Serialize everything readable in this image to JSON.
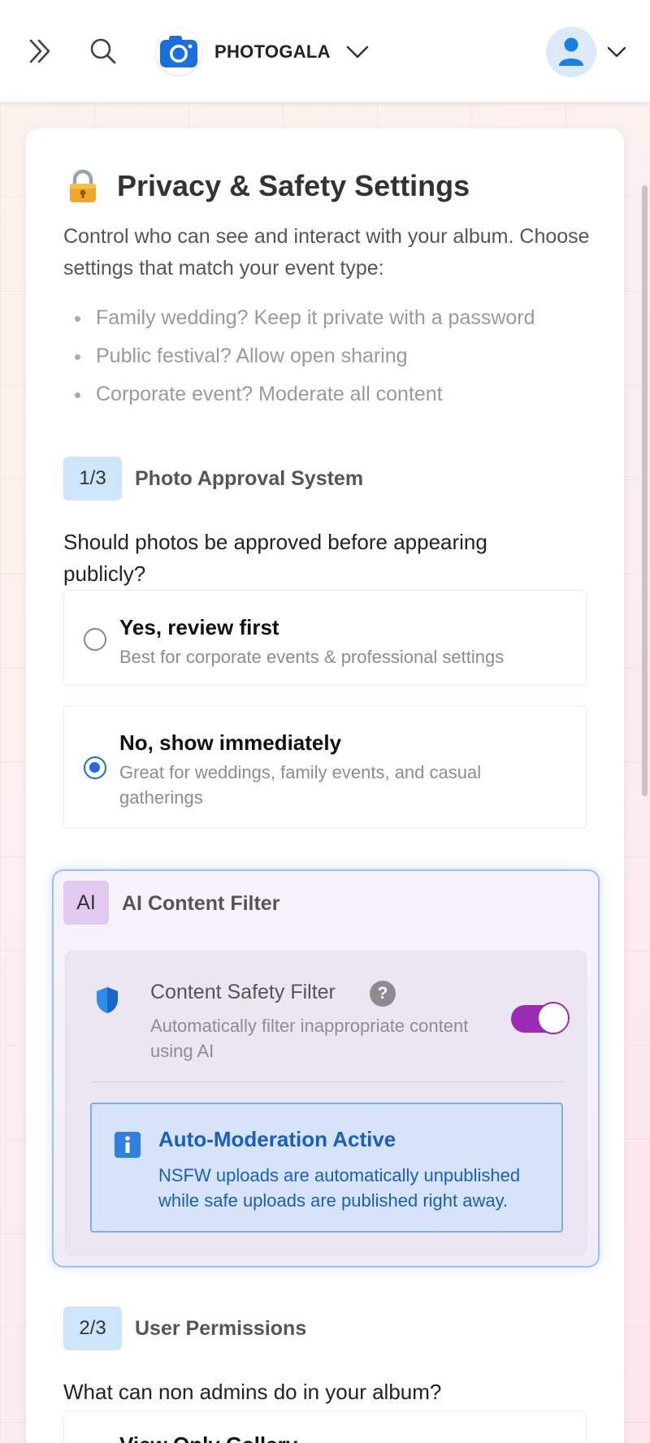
{
  "header": {
    "brand_name": "PHOTOGALA",
    "icons": [
      "double-chevron-right-icon",
      "search-icon",
      "camera-icon",
      "chevron-down-icon",
      "user-icon"
    ]
  },
  "page": {
    "title": "Privacy & Safety Settings",
    "intro": "Control who can see and interact with your album. Choose settings that match your event type:",
    "bullets": [
      "Family wedding? Keep it private with a password",
      "Public festival? Allow open sharing",
      "Corporate event? Moderate all content"
    ]
  },
  "section1": {
    "step": "1/3",
    "title": "Photo Approval System",
    "question": "Should photos be approved before appearing publicly?",
    "options": [
      {
        "label": "Yes, review first",
        "desc": "Best for corporate events & professional settings",
        "checked": false
      },
      {
        "label": "No, show immediately",
        "desc": "Great for weddings, family events, and casual gatherings",
        "checked": true
      }
    ]
  },
  "ai": {
    "badge": "AI",
    "title": "AI Content Filter",
    "filter_title": "Content Safety Filter",
    "help": "?",
    "filter_desc": "Automatically filter inappropriate content using AI",
    "toggle_on": true,
    "info_title": "Auto-Moderation Active",
    "info_text": "NSFW uploads are automatically unpublished while safe uploads are published right away."
  },
  "section2": {
    "step": "2/3",
    "title": "User Permissions",
    "question": "What can non admins do in your album?",
    "options": [
      {
        "label": "View Only Gallery"
      }
    ]
  },
  "colors": {
    "accent_blue": "#1a6fe0",
    "toggle_purple": "#9a2cb4",
    "info_blue": "#1b5fbd",
    "step_badge_bg": "#cde6fb",
    "ai_badge_bg": "#e2c9ef"
  }
}
